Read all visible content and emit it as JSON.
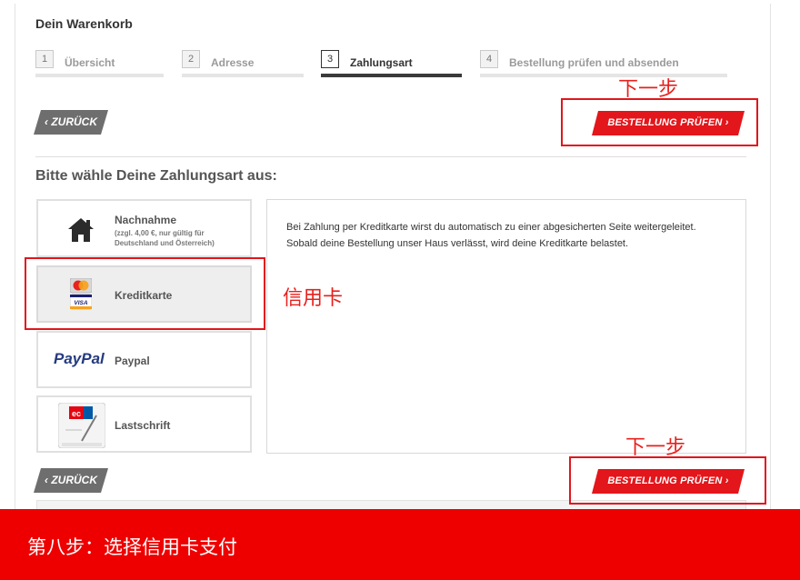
{
  "cart": {
    "title": "Dein Warenkorb"
  },
  "steps": [
    {
      "number": "1",
      "label": "Übersicht"
    },
    {
      "number": "2",
      "label": "Adresse"
    },
    {
      "number": "3",
      "label": "Zahlungsart"
    },
    {
      "number": "4",
      "label": "Bestellung prüfen und absenden"
    }
  ],
  "active_step": 3,
  "buttons": {
    "back_label": "‹ ZURÜCK",
    "next_label": "BESTELLUNG PRÜFEN ›"
  },
  "payment": {
    "heading": "Bitte wähle Deine Zahlungsart aus:",
    "selected": "Kreditkarte",
    "options": [
      {
        "title": "Nachnahme",
        "note": "(zzgl. 4,00 €, nur gültig für Deutschland und Österreich)",
        "icon": "house-icon"
      },
      {
        "title": "Kreditkarte",
        "note": "",
        "icon": "credit-card-icon"
      },
      {
        "title": "Paypal",
        "note": "",
        "icon": "paypal-logo",
        "logo_text": "PayPal"
      },
      {
        "title": "Lastschrift",
        "note": "",
        "icon": "ec-card-icon"
      }
    ],
    "info_lines": [
      "Bei Zahlung per Kreditkarte wirst du automatisch zu einer abgesicherten Seite weitergeleitet.",
      "Sobald deine Bestellung unser Haus verlässt, wird deine Kreditkarte belastet."
    ]
  },
  "annotations": {
    "next_step_top": "下一步",
    "credit_card": "信用卡",
    "next_step_bottom": "下一步"
  },
  "banner": {
    "text": "第八步：选择信用卡支付"
  },
  "colors": {
    "accent": "#e3161b",
    "banner": "#ee0000",
    "back_button": "#6e6e6e"
  }
}
